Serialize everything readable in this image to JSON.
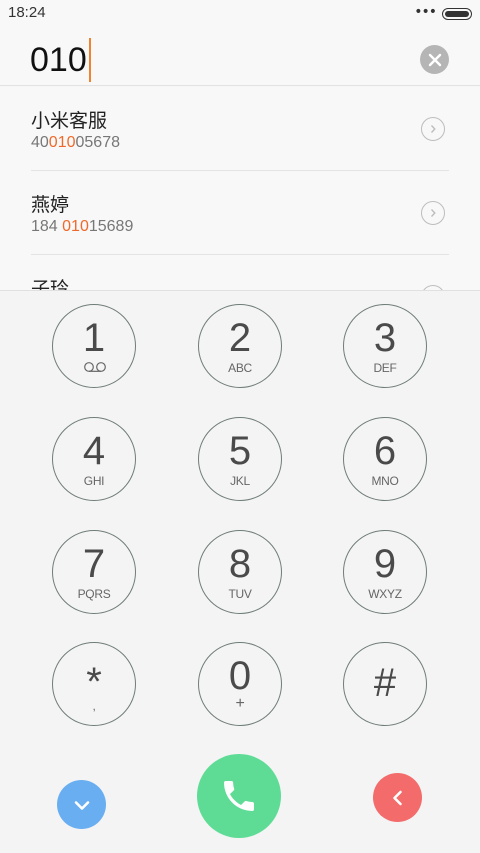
{
  "status_bar": {
    "time": "18:24",
    "dots": "•••"
  },
  "input": {
    "value": "010"
  },
  "results": [
    {
      "name": "小米客服",
      "number_pre": "40",
      "number_hl": "010",
      "number_post": "05678"
    },
    {
      "name": "燕婷",
      "number_pre": "184 ",
      "number_hl": "010",
      "number_post": "15689"
    },
    {
      "name": "子玲",
      "number_pre": "",
      "number_hl": "",
      "number_post": ""
    }
  ],
  "keypad": {
    "keys": [
      {
        "digit": "1",
        "sub": ""
      },
      {
        "digit": "2",
        "sub": "ABC"
      },
      {
        "digit": "3",
        "sub": "DEF"
      },
      {
        "digit": "4",
        "sub": "GHI"
      },
      {
        "digit": "5",
        "sub": "JKL"
      },
      {
        "digit": "6",
        "sub": "MNO"
      },
      {
        "digit": "7",
        "sub": "PQRS"
      },
      {
        "digit": "8",
        "sub": "TUV"
      },
      {
        "digit": "9",
        "sub": "WXYZ"
      },
      {
        "digit": "*",
        "sub": ","
      },
      {
        "digit": "0",
        "sub": "+"
      },
      {
        "digit": "#",
        "sub": ""
      }
    ]
  },
  "colors": {
    "highlight": "#ef6a2a",
    "cursor": "#f0842e",
    "collapse": "#6aaef2",
    "call": "#5edc96",
    "delete": "#f36b6b"
  },
  "icons": {
    "clear": "close-icon",
    "detail": "chevron-right-icon",
    "voicemail": "voicemail-icon",
    "collapse": "chevron-down-icon",
    "call": "phone-icon",
    "delete": "chevron-left-icon"
  }
}
